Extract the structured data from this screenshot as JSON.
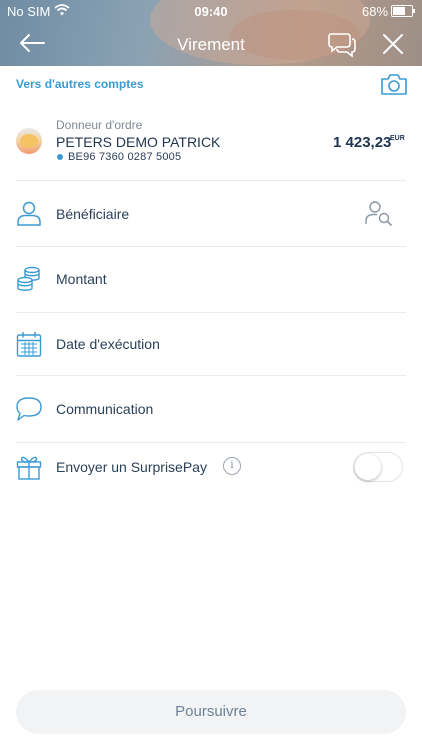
{
  "status_bar": {
    "carrier": "No SIM",
    "time": "09:40",
    "battery": "68%"
  },
  "nav": {
    "title": "Virement",
    "back_icon": "back-arrow-icon",
    "chat_icon": "chat-icon",
    "close_icon": "close-icon"
  },
  "accounts_link": "Vers d'autres comptes",
  "orderer": {
    "label": "Donneur d'ordre",
    "name": "PETERS DEMO PATRICK",
    "iban": "BE96 7360 0287 5005",
    "balance": "1 423,23",
    "currency": "EUR"
  },
  "rows": {
    "beneficiary": "Bénéficiaire",
    "amount": "Montant",
    "execution_date": "Date d'exécution",
    "communication": "Communication",
    "surprisepay": "Envoyer un SurprisePay"
  },
  "surprisepay_enabled": false,
  "continue_button": "Poursuivre",
  "colors": {
    "accent": "#3a9bd4",
    "text": "#1f3550",
    "icon": "#3a9bd4"
  }
}
